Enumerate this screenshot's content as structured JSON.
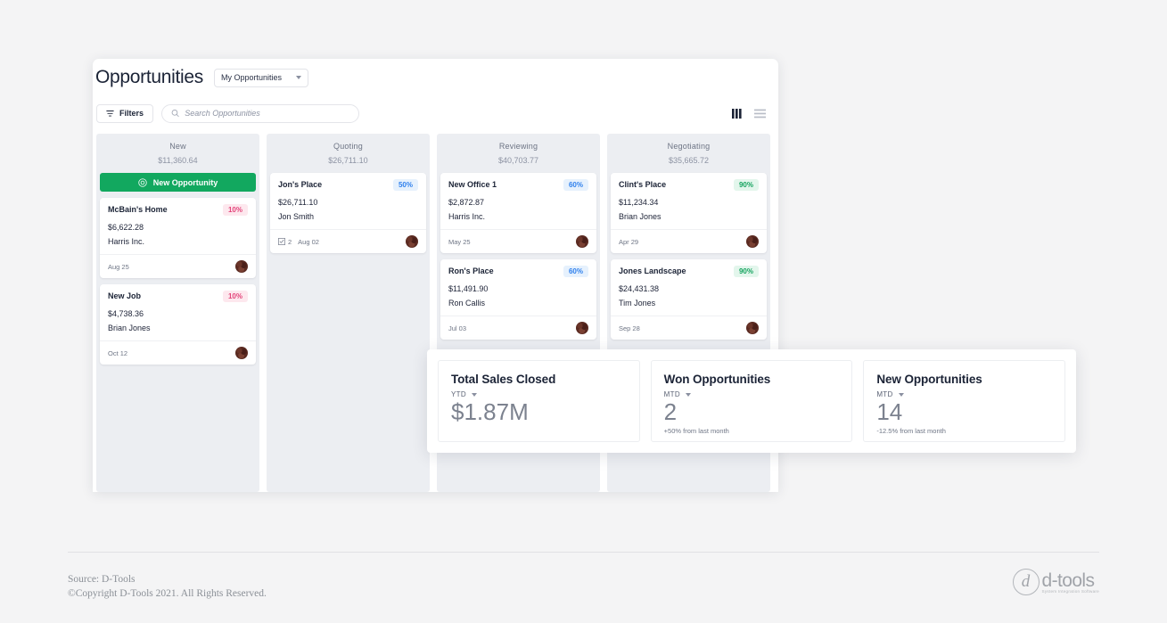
{
  "app": {
    "title": "Opportunities",
    "scope_select": {
      "label": "My Opportunities",
      "icon": "chevron-down-icon"
    },
    "toolbar": {
      "filters_label": "Filters",
      "filters_icon": "filter-icon",
      "search_placeholder": "Search Opportunities",
      "search_value": "",
      "search_icon": "search-icon",
      "view_board_icon": "columns-view-icon",
      "view_list_icon": "list-view-icon"
    },
    "new_opportunity": {
      "label": "New Opportunity",
      "icon": "target-circle-icon"
    }
  },
  "board": {
    "columns": [
      {
        "title": "New",
        "total": "$11,360.64",
        "has_new_button": true,
        "cards": [
          {
            "title": "McBain's Home",
            "pct": "10%",
            "pct_class": "p10",
            "amount": "$6,622.28",
            "client": "Harris Inc.",
            "date": "Aug 25",
            "tasks": ""
          },
          {
            "title": "New Job",
            "pct": "10%",
            "pct_class": "p10",
            "amount": "$4,738.36",
            "client": "Brian Jones",
            "date": "Oct 12",
            "tasks": ""
          }
        ]
      },
      {
        "title": "Quoting",
        "total": "$26,711.10",
        "has_new_button": false,
        "cards": [
          {
            "title": "Jon's Place",
            "pct": "50%",
            "pct_class": "p50",
            "amount": "$26,711.10",
            "client": "Jon Smith",
            "date": "Aug 02",
            "tasks": "2"
          }
        ]
      },
      {
        "title": "Reviewing",
        "total": "$40,703.77",
        "has_new_button": false,
        "cards": [
          {
            "title": "New Office 1",
            "pct": "60%",
            "pct_class": "p60",
            "amount": "$2,872.87",
            "client": "Harris Inc.",
            "date": "May 25",
            "tasks": ""
          },
          {
            "title": "Ron's Place",
            "pct": "60%",
            "pct_class": "p60",
            "amount": "$11,491.90",
            "client": "Ron Callis",
            "date": "Jul 03",
            "tasks": ""
          }
        ]
      },
      {
        "title": "Negotiating",
        "total": "$35,665.72",
        "has_new_button": false,
        "cards": [
          {
            "title": "Clint's Place",
            "pct": "90%",
            "pct_class": "p90",
            "amount": "$11,234.34",
            "client": "Brian Jones",
            "date": "Apr 29",
            "tasks": ""
          },
          {
            "title": "Jones Landscape",
            "pct": "90%",
            "pct_class": "p90",
            "amount": "$24,431.38",
            "client": "Tim Jones",
            "date": "Sep 28",
            "tasks": ""
          }
        ]
      }
    ]
  },
  "stats": [
    {
      "title": "Total Sales Closed",
      "period": "YTD",
      "value": "$1.87M",
      "delta": ""
    },
    {
      "title": "Won Opportunities",
      "period": "MTD",
      "value": "2",
      "delta": "+50% from last month"
    },
    {
      "title": "New Opportunities",
      "period": "MTD",
      "value": "14",
      "delta": "-12.5% from last month"
    }
  ],
  "footer": {
    "source": "Source: D-Tools",
    "copyright": "©Copyright D-Tools 2021. All Rights Reserved.",
    "logo_mark": "d",
    "logo_text": "d-tools",
    "logo_tagline": "System Integration Software"
  },
  "colors": {
    "accent_green": "#12a85f",
    "badge_pink": "#e3447a",
    "badge_blue": "#2f80ed",
    "badge_green": "#14a35e",
    "page_bg": "#f4f4f5"
  }
}
